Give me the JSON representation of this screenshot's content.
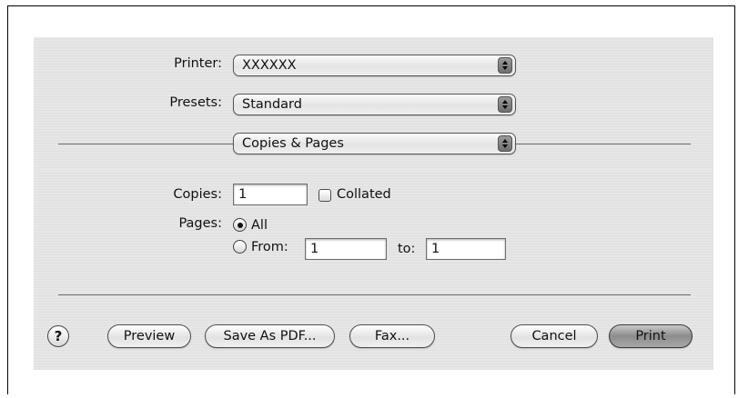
{
  "printer": {
    "label": "Printer:",
    "value": "XXXXXX"
  },
  "presets": {
    "label": "Presets:",
    "value": "Standard"
  },
  "panel": {
    "value": "Copies & Pages"
  },
  "copies": {
    "label": "Copies:",
    "value": "1",
    "collated_label": "Collated",
    "collated_checked": false
  },
  "pages": {
    "label": "Pages:",
    "all_label": "All",
    "all_selected": true,
    "from_label": "From:",
    "from_value": "1",
    "to_label": "to:",
    "to_value": "1"
  },
  "buttons": {
    "help": "?",
    "preview": "Preview",
    "save_pdf": "Save As PDF...",
    "fax": "Fax...",
    "cancel": "Cancel",
    "print": "Print"
  },
  "icons": [
    "popup-arrows-icon",
    "help-icon"
  ]
}
